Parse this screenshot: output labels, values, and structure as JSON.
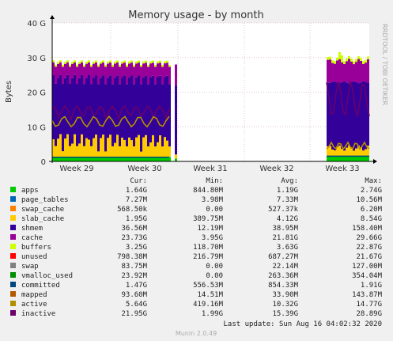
{
  "chart_data": {
    "type": "area",
    "title": "Memory usage - by month",
    "ylabel": "Bytes",
    "xlabel": "",
    "side_text": "RRDTOOL / TOBI OETIKER",
    "y_ticks": [
      "0",
      "10 G",
      "20 G",
      "30 G",
      "40 G"
    ],
    "ylim_gb": [
      0,
      40
    ],
    "x_ticks": [
      "Week 29",
      "Week 30",
      "Week 31",
      "Week 32",
      "Week 33"
    ],
    "grid": true,
    "legend_placement": "bottom",
    "column_headers": [
      "Cur:",
      "Min:",
      "Avg:",
      "Max:"
    ],
    "series": [
      {
        "name": "apps",
        "color": "#00cc00",
        "cur": "1.64G",
        "min": "844.80M",
        "avg": "1.19G",
        "max": "2.74G"
      },
      {
        "name": "page_tables",
        "color": "#0066b3",
        "cur": "7.27M",
        "min": "3.98M",
        "avg": "7.33M",
        "max": "10.56M"
      },
      {
        "name": "swap_cache",
        "color": "#ff8000",
        "cur": "568.50k",
        "min": "0.00",
        "avg": "527.37k",
        "max": "6.20M"
      },
      {
        "name": "slab_cache",
        "color": "#ffcc00",
        "cur": "1.95G",
        "min": "389.75M",
        "avg": "4.12G",
        "max": "8.54G"
      },
      {
        "name": "shmem",
        "color": "#330099",
        "cur": "36.56M",
        "min": "12.19M",
        "avg": "38.95M",
        "max": "158.40M"
      },
      {
        "name": "cache",
        "color": "#990099",
        "cur": "23.73G",
        "min": "3.95G",
        "avg": "21.81G",
        "max": "29.66G"
      },
      {
        "name": "buffers",
        "color": "#ccff00",
        "cur": "3.25G",
        "min": "118.70M",
        "avg": "3.63G",
        "max": "22.87G"
      },
      {
        "name": "unused",
        "color": "#ff0000",
        "cur": "798.38M",
        "min": "216.79M",
        "avg": "687.27M",
        "max": "21.67G"
      },
      {
        "name": "swap",
        "color": "#808080",
        "cur": "83.75M",
        "min": "0.00",
        "avg": "22.14M",
        "max": "127.00M"
      },
      {
        "name": "vmalloc_used",
        "color": "#008f00",
        "cur": "23.92M",
        "min": "0.00",
        "avg": "263.36M",
        "max": "354.04M"
      },
      {
        "name": "committed",
        "color": "#00487d",
        "cur": "1.47G",
        "min": "556.53M",
        "avg": "854.33M",
        "max": "1.91G"
      },
      {
        "name": "mapped",
        "color": "#b35a00",
        "cur": "93.60M",
        "min": "14.51M",
        "avg": "33.90M",
        "max": "143.87M"
      },
      {
        "name": "active",
        "color": "#b38f00",
        "cur": "5.64G",
        "min": "419.16M",
        "avg": "10.32G",
        "max": "14.77G"
      },
      {
        "name": "inactive",
        "color": "#6b006b",
        "cur": "21.95G",
        "min": "1.99G",
        "avg": "15.39G",
        "max": "28.89G"
      }
    ],
    "last_update": "Last update: Sun Aug 16 04:02:32 2020",
    "footer": "Munin 2.0.49"
  }
}
